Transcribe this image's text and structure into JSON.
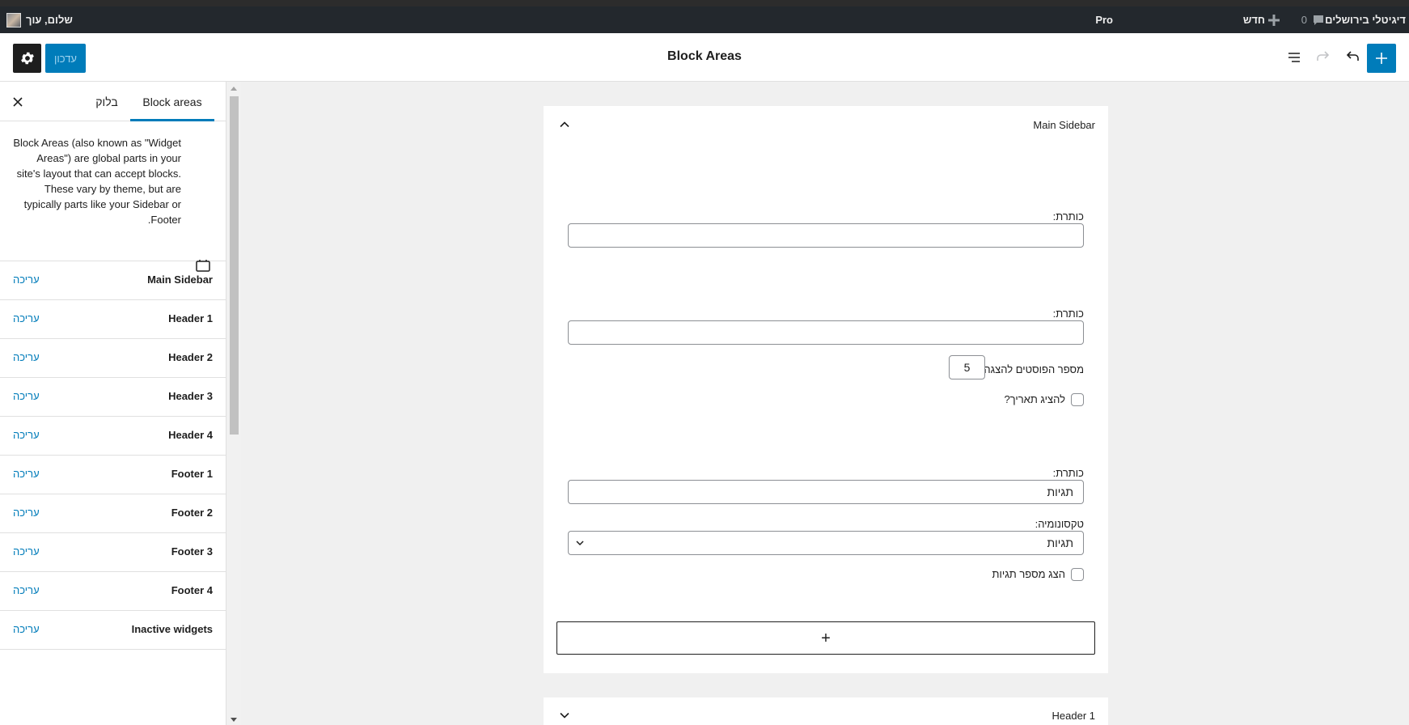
{
  "admin_bar": {
    "site_name": "דיגיטלי בירושלים",
    "comments_count": "0",
    "new_label": "חדש",
    "pro_label": "Pro",
    "howdy": "שלום, עוך"
  },
  "header": {
    "title": "Block Areas",
    "update_label": "עדכון",
    "icons": [
      "settings-gear-icon",
      "add-block-icon",
      "undo-icon",
      "redo-icon",
      "list-view-icon"
    ]
  },
  "sidebar": {
    "tabs": [
      "Block areas",
      "בלוק"
    ],
    "description": "Block Areas (also known as \"Widget Areas\") are global parts in your site's layout that can accept blocks. These vary by theme, but are typically parts like your Sidebar or Footer.",
    "edit_label": "עריכה",
    "areas": [
      {
        "name": "Main Sidebar"
      },
      {
        "name": "Header 1"
      },
      {
        "name": "Header 2"
      },
      {
        "name": "Header 3"
      },
      {
        "name": "Header 4"
      },
      {
        "name": "Footer 1"
      },
      {
        "name": "Footer 2"
      },
      {
        "name": "Footer 3"
      },
      {
        "name": "Footer 4"
      },
      {
        "name": "Inactive widgets"
      }
    ]
  },
  "main_panel": {
    "title": "Main Sidebar",
    "widget1": {
      "title_label": "כותרת:",
      "title_value": ""
    },
    "widget2": {
      "title_label": "כותרת:",
      "title_value": "",
      "posts_label": "מספר הפוסטים להצגה:",
      "posts_value": "5",
      "show_date_label": "להציג תאריך?"
    },
    "widget3": {
      "title_label": "כותרת:",
      "title_value": "תגיות",
      "taxonomy_label": "טקסונומיה:",
      "taxonomy_value": "תגיות",
      "show_count_label": "הצג מספר תגיות"
    },
    "appender_symbol": "+"
  },
  "header1_panel": {
    "title": "Header 1"
  }
}
